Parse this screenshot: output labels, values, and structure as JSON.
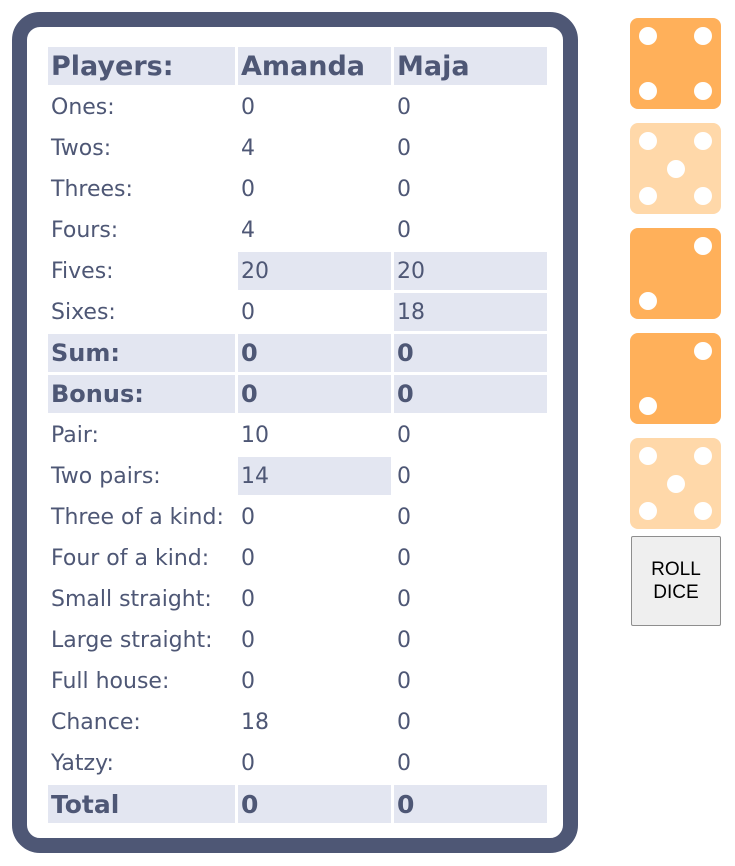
{
  "scoreboard": {
    "header": {
      "label": "Players:",
      "players": [
        "Amanda",
        "Maja"
      ]
    },
    "rows": [
      {
        "label": "Ones:",
        "values": [
          "0",
          "0"
        ]
      },
      {
        "label": "Twos:",
        "values": [
          "4",
          "0"
        ]
      },
      {
        "label": "Threes:",
        "values": [
          "0",
          "0"
        ]
      },
      {
        "label": "Fours:",
        "values": [
          "4",
          "0"
        ]
      },
      {
        "label": "Fives:",
        "values": [
          "20",
          "20"
        ]
      },
      {
        "label": "Sixes:",
        "values": [
          "0",
          "18"
        ]
      },
      {
        "label": "Sum:",
        "values": [
          "0",
          "0"
        ]
      },
      {
        "label": "Bonus:",
        "values": [
          "0",
          "0"
        ]
      },
      {
        "label": "Pair:",
        "values": [
          "10",
          "0"
        ]
      },
      {
        "label": "Two pairs:",
        "values": [
          "14",
          "0"
        ]
      },
      {
        "label": "Three of a kind:",
        "values": [
          "0",
          "0"
        ]
      },
      {
        "label": "Four of a kind:",
        "values": [
          "0",
          "0"
        ]
      },
      {
        "label": "Small straight:",
        "values": [
          "0",
          "0"
        ]
      },
      {
        "label": "Large straight:",
        "values": [
          "0",
          "0"
        ]
      },
      {
        "label": "Full house:",
        "values": [
          "0",
          "0"
        ]
      },
      {
        "label": "Chance:",
        "values": [
          "18",
          "0"
        ]
      },
      {
        "label": "Yatzy:",
        "values": [
          "0",
          "0"
        ]
      }
    ],
    "total": {
      "label": "Total",
      "values": [
        "0",
        "0"
      ]
    }
  },
  "dice": [
    {
      "value": 4,
      "held": false
    },
    {
      "value": 5,
      "held": true
    },
    {
      "value": 2,
      "held": false
    },
    {
      "value": 2,
      "held": false
    },
    {
      "value": 5,
      "held": true
    }
  ],
  "roll_button": {
    "line1": "ROLL",
    "line2": "DICE"
  },
  "colors": {
    "frame": "#4e5775",
    "highlight": "#e3e6f1",
    "die": "#ffb05a",
    "die_held": "#ffd8a9"
  }
}
